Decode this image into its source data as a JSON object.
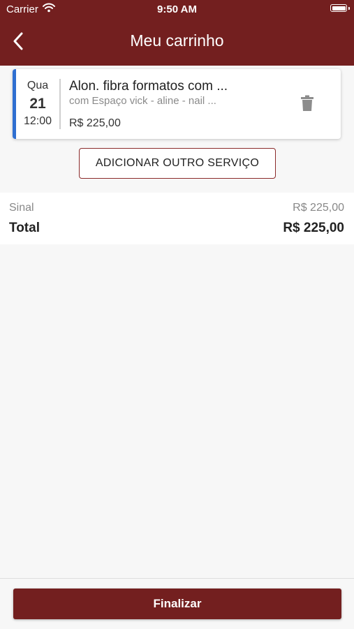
{
  "status_bar": {
    "carrier": "Carrier",
    "time": "9:50 AM"
  },
  "header": {
    "title": "Meu carrinho",
    "back_icon": "chevron-left-icon"
  },
  "cart_item": {
    "weekday": "Qua",
    "day": "21",
    "time": "12:00",
    "service_name": "Alon. fibra formatos com ...",
    "professional": "com Espaço vick - aline - nail ...",
    "price": "R$ 225,00",
    "accent_color": "#2f6fd1",
    "delete_icon": "trash-icon"
  },
  "add_service": {
    "label": "ADICIONAR OUTRO SERVIÇO"
  },
  "summary": {
    "sinal_label": "Sinal",
    "sinal_value": "R$ 225,00",
    "total_label": "Total",
    "total_value": "R$ 225,00"
  },
  "footer": {
    "finalize_label": "Finalizar"
  },
  "colors": {
    "brand": "#731f1f",
    "background": "#f7f7f7"
  }
}
